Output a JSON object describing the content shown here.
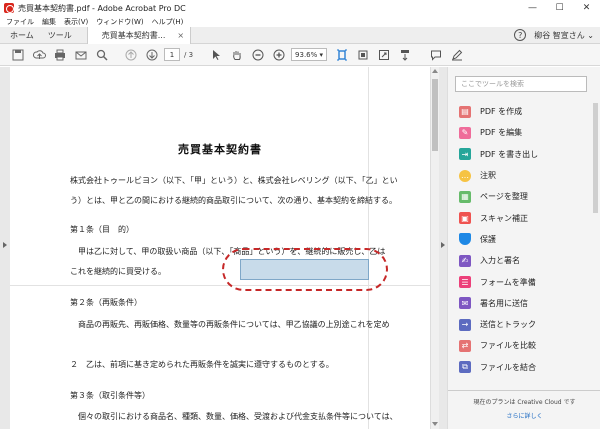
{
  "titlebar": {
    "title": "売買基本契約書.pdf - Adobe Acrobat Pro DC",
    "minimize": "—",
    "maximize": "☐",
    "close": "✕"
  },
  "menu": [
    "ファイル",
    "編集",
    "表示(V)",
    "ウィンドウ(W)",
    "ヘルプ(H)"
  ],
  "tabs": {
    "home": "ホーム",
    "tools": "ツール",
    "document": "売買基本契約書...",
    "close": "×"
  },
  "account": {
    "help": "?",
    "user": "柳谷 智宣さん ⌄"
  },
  "toolbar": {
    "page_current": "1",
    "page_total": "/ 3",
    "zoom": "93.6%",
    "zoom_arrow": "▾"
  },
  "document": {
    "title": "売買基本契約書",
    "lines": [
      "株式会社トゥールビヨン（以下、「甲」という）と、株式会社レベリング（以下、「乙」とい",
      "う）とは、甲と乙の間における継続的商品取引について、次の通り、基本契約を締結する。",
      "第１条（目　的）",
      "　甲は乙に対して、甲の取扱い商品（以下、「商品」という）を、継続的に販売し、乙は",
      "これを継続的に買受ける。",
      "第２条（再販条件）",
      "　商品の再販先、再販価格、数量等の再販条件については、甲乙協議の上別途これを定め",
      "２　乙は、前項に基き定められた再販条件を誠実に遵守するものとする。",
      "第３条（取引条件等）",
      "　個々の取引における商品名、種類、数量、価格、受渡および代金支払条件等については、"
    ]
  },
  "tools_pane": {
    "search_placeholder": "ここでツールを検索",
    "items": [
      {
        "label": "PDF を作成",
        "icon": "create-pdf-icon",
        "color": "#e57373"
      },
      {
        "label": "PDF を編集",
        "icon": "edit-pdf-icon",
        "color": "#ef6c9a"
      },
      {
        "label": "PDF を書き出し",
        "icon": "export-pdf-icon",
        "color": "#26a69a"
      },
      {
        "label": "注釈",
        "icon": "comment-icon",
        "color": "#f6c343"
      },
      {
        "label": "ページを整理",
        "icon": "organize-pages-icon",
        "color": "#66bb6a"
      },
      {
        "label": "スキャン補正",
        "icon": "scan-icon",
        "color": "#ef5350"
      },
      {
        "label": "保護",
        "icon": "protect-icon",
        "color": "#1e88e5"
      },
      {
        "label": "入力と署名",
        "icon": "fill-sign-icon",
        "color": "#7e57c2"
      },
      {
        "label": "フォームを準備",
        "icon": "prepare-form-icon",
        "color": "#ec407a"
      },
      {
        "label": "署名用に送信",
        "icon": "send-sign-icon",
        "color": "#7e57c2"
      },
      {
        "label": "送信とトラック",
        "icon": "send-track-icon",
        "color": "#5c6bc0"
      },
      {
        "label": "ファイルを比較",
        "icon": "compare-icon",
        "color": "#e57373"
      },
      {
        "label": "ファイルを結合",
        "icon": "combine-icon",
        "color": "#5c6bc0"
      }
    ],
    "footer_text": "現在のプランは Creative Cloud です",
    "footer_link": "さらに詳しく"
  }
}
